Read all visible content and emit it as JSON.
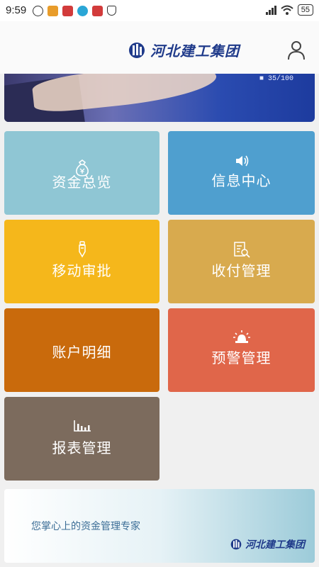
{
  "status_bar": {
    "time": "9:59",
    "battery": "55"
  },
  "header": {
    "logo_text": "河北建工集团",
    "icons": {
      "logo": "company-logo",
      "user": "user-icon"
    }
  },
  "banner": {
    "counter": "35/100"
  },
  "tiles": [
    {
      "label": "资金总览",
      "icon": "money-bag-icon",
      "color": "#8fc6d4"
    },
    {
      "label": "信息中心",
      "icon": "speaker-icon",
      "color": "#4f9fcf"
    },
    {
      "label": "移动审批",
      "icon": "pen-icon",
      "color": "#f5b71b"
    },
    {
      "label": "收付管理",
      "icon": "document-search-icon",
      "color": "#d8aa4e"
    },
    {
      "label": "账户明细",
      "icon": "",
      "color": "#c96a0c"
    },
    {
      "label": "预警管理",
      "icon": "alarm-light-icon",
      "color": "#e0664a"
    },
    {
      "label": "报表管理",
      "icon": "bar-chart-icon",
      "color": "#7c6b5d"
    }
  ],
  "footer": {
    "slogan": "您掌心上的资金管理专家",
    "logo_text": "河北建工集团"
  }
}
